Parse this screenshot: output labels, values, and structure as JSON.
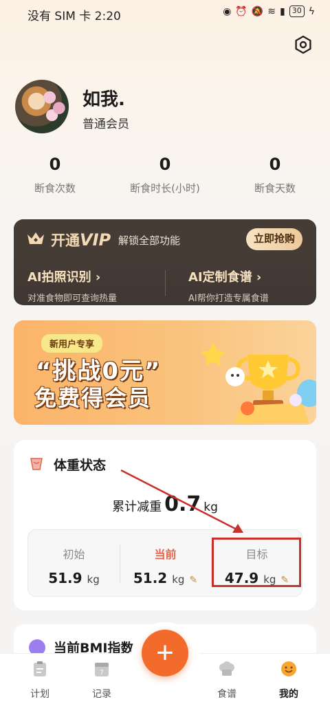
{
  "status_bar": {
    "carrier_time": "没有 SIM 卡 2:20",
    "battery": "30",
    "icons": [
      "eye-icon",
      "alarm-icon",
      "mute-icon",
      "wifi-icon",
      "sim-alert-icon",
      "battery-icon",
      "charging-icon"
    ]
  },
  "profile": {
    "username": "如我.",
    "member_level": "普通会员"
  },
  "stats": [
    {
      "value": "0",
      "label": "断食次数"
    },
    {
      "value": "0",
      "label": "断食时长(小时)"
    },
    {
      "value": "0",
      "label": "断食天数"
    }
  ],
  "vip": {
    "title_prefix": "开通",
    "title_vip": "VIP",
    "subtitle": "解锁全部功能",
    "button": "立即抢购",
    "features": [
      {
        "title": "AI拍照识别 ›",
        "desc": "对准食物即可查询热量"
      },
      {
        "title": "AI定制食谱 ›",
        "desc": "AI帮你打造专属食谱"
      }
    ]
  },
  "banner": {
    "tag": "新用户专享",
    "line1": "“挑战0元”",
    "line2": "免费得会员"
  },
  "weight": {
    "title": "体重状态",
    "cumulative_label": "累计减重",
    "cumulative_value": "0.7",
    "cumulative_unit": "kg",
    "items": [
      {
        "label": "初始",
        "value": "51.9",
        "unit": "kg"
      },
      {
        "label": "当前",
        "value": "51.2",
        "unit": "kg"
      },
      {
        "label": "目标",
        "value": "47.9",
        "unit": "kg"
      }
    ]
  },
  "bmi": {
    "title": "当前BMI指数"
  },
  "fab": {
    "label": "+"
  },
  "tabs": [
    {
      "label": "计划"
    },
    {
      "label": "记录"
    },
    {
      "label": "食谱"
    },
    {
      "label": "我的"
    }
  ],
  "colors": {
    "accent": "#f26b2a",
    "current_label": "#e2644a",
    "highlight_box": "#c8302a",
    "vip_bg": "#463c36",
    "vip_gold": "#f4d9b5"
  }
}
